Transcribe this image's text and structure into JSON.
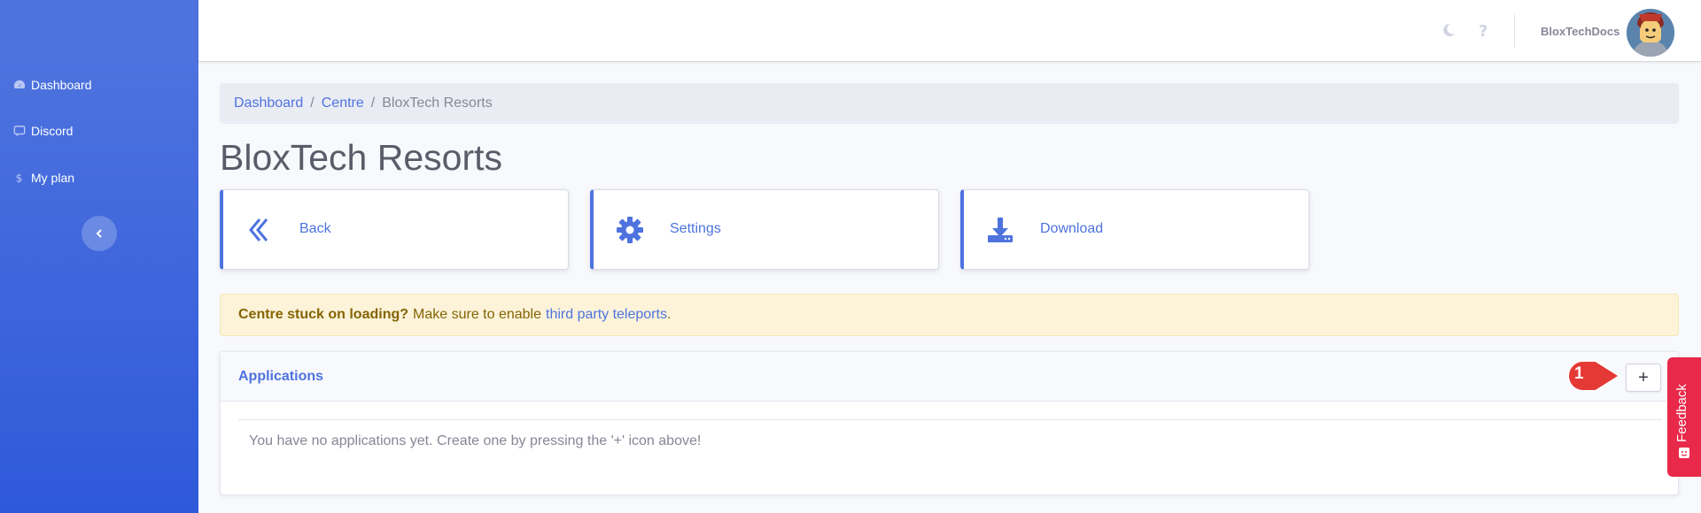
{
  "sidebar": {
    "items": [
      {
        "label": "Dashboard",
        "icon": "tachometer-icon"
      },
      {
        "label": "Discord",
        "icon": "discord-icon"
      },
      {
        "label": "My plan",
        "icon": "dollar-icon"
      }
    ],
    "toggle_icon": "chevron-left-icon"
  },
  "topbar": {
    "username": "BloxTechDocs",
    "icons": [
      "moon-icon",
      "question-icon"
    ]
  },
  "breadcrumb": {
    "items": [
      "Dashboard",
      "Centre"
    ],
    "separator": "/",
    "current": "BloxTech Resorts"
  },
  "page": {
    "title": "BloxTech Resorts"
  },
  "actions": [
    {
      "label": "Back",
      "icon": "chevron-left-icon"
    },
    {
      "label": "Settings",
      "icon": "gear-icon"
    },
    {
      "label": "Download",
      "icon": "download-icon"
    }
  ],
  "alert": {
    "bold": "Centre stuck on loading?",
    "text": "Make sure to enable",
    "link": "third party teleports",
    "end": "."
  },
  "applications": {
    "title": "Applications",
    "add_label": "+",
    "empty_text": "You have no applications yet. Create one by pressing the '+' icon above!"
  },
  "annotation": {
    "number": "1"
  },
  "feedback": {
    "label": "Feedback"
  },
  "colors": {
    "primary": "#4e73df",
    "sidebar_gradient_start": "#4e73df",
    "sidebar_gradient_end": "#2e59d9",
    "alert_bg": "#fcf3d9",
    "feedback": "#e8294a",
    "marker": "#e53935"
  }
}
